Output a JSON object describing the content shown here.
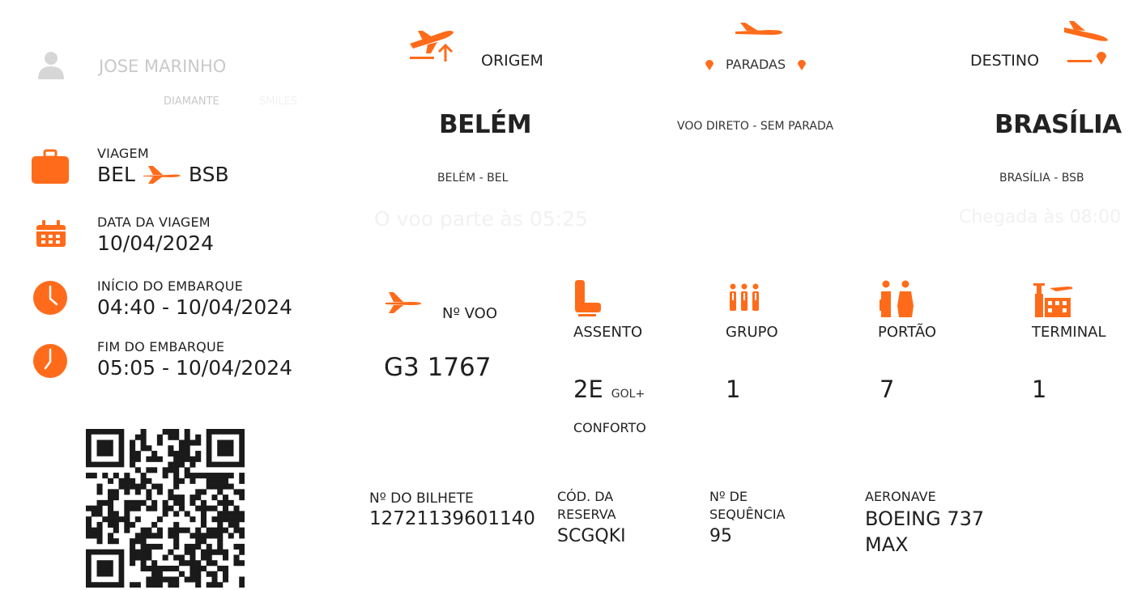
{
  "passenger": {
    "name": "JOSE MARINHO",
    "tier": "DIAMANTE",
    "tier_extra": "SMILES"
  },
  "trip": {
    "label": "VIAGEM",
    "from": "BEL",
    "to": "BSB",
    "date_label": "DATA DA VIAGEM",
    "date": "10/04/2024",
    "boarding_start_label": "INÍCIO DO EMBARQUE",
    "boarding_start": "04:40 - 10/04/2024",
    "boarding_end_label": "FIM DO EMBARQUE",
    "boarding_end": "05:05 - 10/04/2024"
  },
  "route": {
    "origin_label": "ORIGEM",
    "origin_city": "BELÉM",
    "origin_airport": "BELÉM - BEL",
    "departure_note": "O voo parte às 05:25",
    "stops_label": "PARADAS",
    "stops_text": "VOO DIRETO - SEM PARADA",
    "destination_label": "DESTINO",
    "destination_city": "BRASÍLIA",
    "destination_airport": "BRASÍLIA - BSB",
    "arrival_note": "Chegada às 08:00"
  },
  "flight": {
    "number_label": "Nº VOO",
    "number": "G3 1767",
    "seat_label": "ASSENTO",
    "seat": "2E",
    "seat_class": "GOL+",
    "seat_class_2": "CONFORTO",
    "group_label": "GRUPO",
    "group": "1",
    "gate_label": "PORTÃO",
    "gate": "7",
    "terminal_label": "TERMINAL",
    "terminal": "1"
  },
  "booking": {
    "ticket_label": "Nº DO BILHETE",
    "ticket": "12721139601140",
    "reservation_label_1": "CÓD. DA",
    "reservation_label_2": "RESERVA",
    "reservation": "SCGQKI",
    "sequence_label_1": "Nº DE",
    "sequence_label_2": "SEQUÊNCIA",
    "sequence": "95",
    "aircraft_label": "AERONAVE",
    "aircraft_1": "BOEING 737",
    "aircraft_2": "MAX"
  },
  "icons": {
    "avatar": "person-icon",
    "trip": "briefcase-icon",
    "date": "calendar-icon",
    "boarding_start": "clock-icon",
    "boarding_end": "clock-icon",
    "origin": "plane-takeoff-icon",
    "stops": "plane-icon",
    "destination": "plane-landing-icon",
    "flight": "plane-icon",
    "seat": "seat-icon",
    "group": "group-icon",
    "gate": "people-icon",
    "terminal": "terminal-icon",
    "code": "qr-code-icon"
  },
  "colors": {
    "accent": "#ff6b1a",
    "text": "#1f1f1f",
    "faded": "#c9c9c9"
  }
}
